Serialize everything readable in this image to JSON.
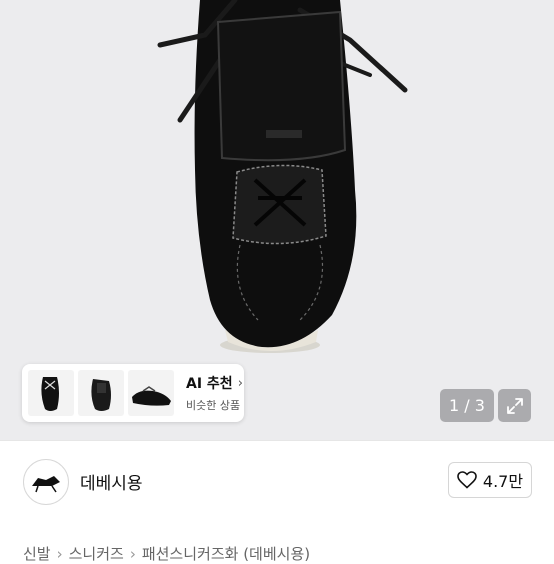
{
  "product_image": {
    "description_icon": "shoe-photo",
    "page_indicator": "1 / 3"
  },
  "ai_recommend": {
    "title": "AI 추천",
    "chevron": "›",
    "subtitle": "비슷한 상품"
  },
  "shop": {
    "name": "데베시용",
    "likes": "4.7만"
  },
  "breadcrumb": {
    "items": [
      "신발",
      "스니커즈",
      "패션스니커즈화",
      "(데베시용)"
    ],
    "separator": "›"
  },
  "colors": {
    "hero_bg": "#ececee",
    "shoe": "#0d0d0d",
    "overlay_btn": "#969698"
  }
}
